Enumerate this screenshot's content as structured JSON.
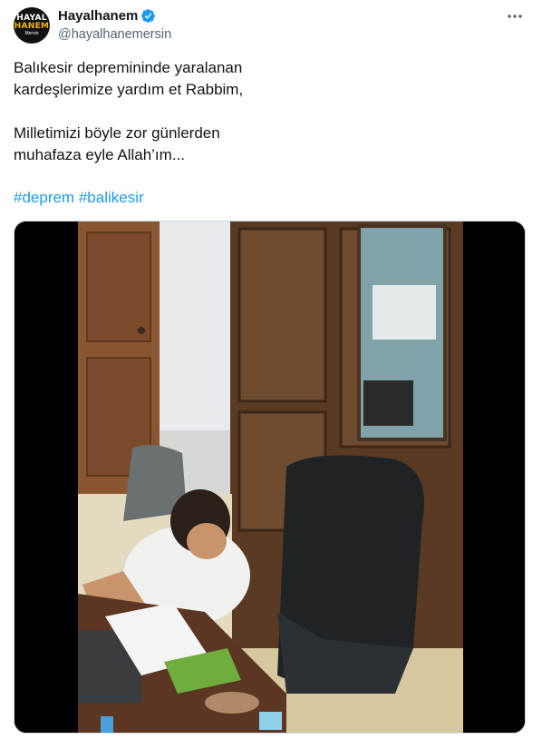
{
  "author": {
    "display_name": "Hayalhanem",
    "handle": "@hayalhanemersin",
    "avatar_logo": {
      "line1": "HAYAL",
      "line2": "HANEM",
      "line3": "Mersin"
    },
    "verified_icon": "verified-badge-icon",
    "verified_color": "#1d9bf0"
  },
  "menu": {
    "icon": "more-dots-icon"
  },
  "tweet": {
    "line1": "Balıkesir depremininde yaralanan",
    "line2": "kardeşlerimize yardım et Rabbim,",
    "line3": "Milletimizi böyle zor günlerden",
    "line4": "muhafaza eyle Allah’ım...",
    "hashtags": [
      "#deprem",
      "#balikesir"
    ]
  },
  "colors": {
    "accent": "#1d9bf0",
    "text": "#0f1419",
    "secondary": "#536471"
  }
}
